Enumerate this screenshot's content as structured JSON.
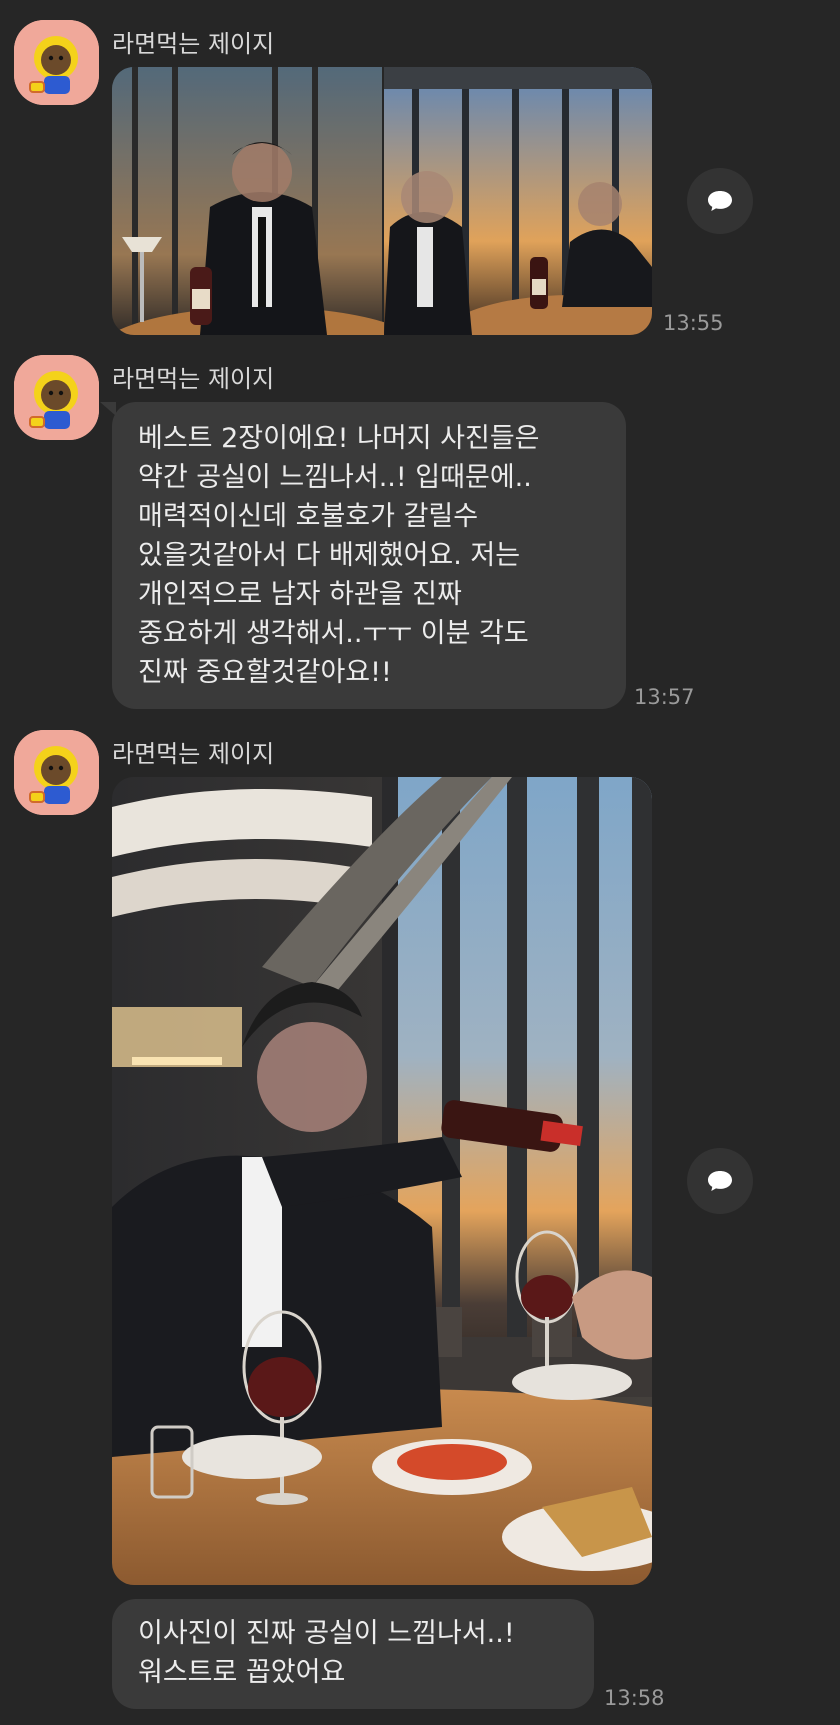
{
  "messages": [
    {
      "sender": "라면먹는 제이지",
      "type": "photos",
      "time": "13:55",
      "photos": [
        {
          "description_icon": "restaurant-photo"
        },
        {
          "description_icon": "restaurant-photo"
        }
      ]
    },
    {
      "sender": "라면먹는 제이지",
      "type": "text",
      "time": "13:57",
      "lines": [
        "베스트 2장이에요! 나머지 사진들은",
        "약간 공실이 느낌나서..! 입때문에..",
        "매력적이신데 호불호가 갈릴수",
        "있을것같아서 다 배제했어요. 저는",
        "개인적으로 남자 하관을 진짜",
        "중요하게 생각해서..ㅜㅜ 이분 각도",
        "진짜 중요할것같아요!!"
      ]
    },
    {
      "sender": "라면먹는 제이지",
      "type": "photo",
      "photos": [
        {
          "description_icon": "restaurant-photo"
        }
      ]
    },
    {
      "type": "text",
      "time": "13:58",
      "lines": [
        "이사진이 진짜 공실이 느낌나서..!",
        "워스트로 꼽았어요"
      ]
    }
  ],
  "icons": {
    "avatar": "character-avatar-icon",
    "share": "speech-bubble-share-icon"
  },
  "colors": {
    "background": "#262626",
    "bubble": "#3a3a3a",
    "avatar_bg": "#f0a89a",
    "text": "#ececec",
    "time": "#9a9a9a"
  }
}
